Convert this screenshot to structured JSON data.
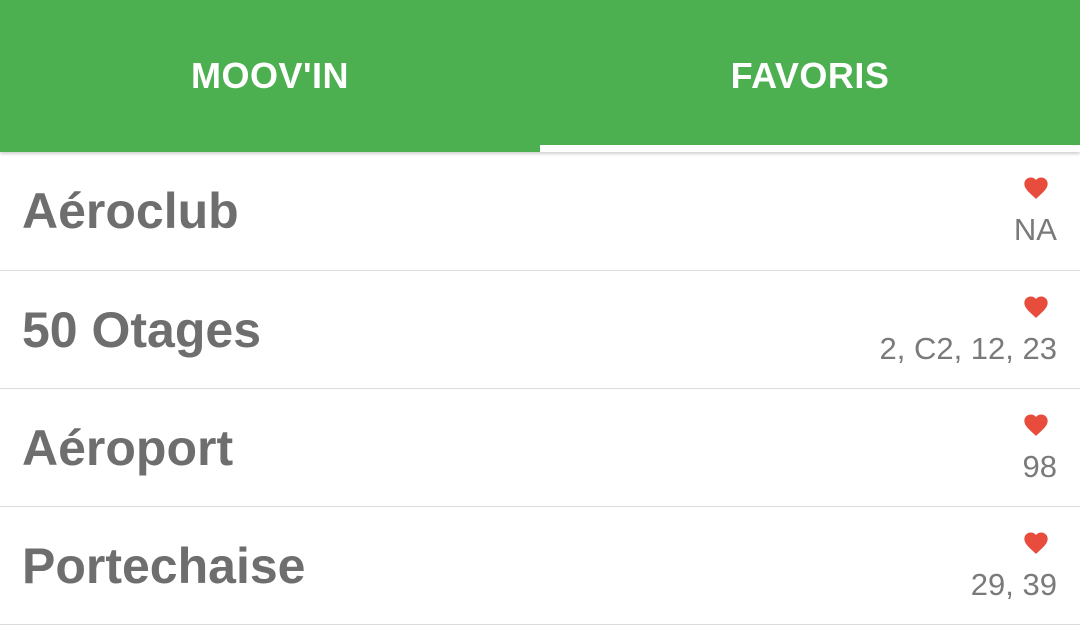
{
  "tabs": [
    {
      "label": "MOOV'IN",
      "active": false
    },
    {
      "label": "FAVORIS",
      "active": true
    }
  ],
  "colors": {
    "accent": "#4caf50",
    "heart": "#e74c3c",
    "text": "#6e6e6e"
  },
  "favorites": [
    {
      "name": "Aéroclub",
      "lines": "NA",
      "icon": "heart-icon"
    },
    {
      "name": "50 Otages",
      "lines": "2, C2, 12, 23",
      "icon": "heart-icon"
    },
    {
      "name": "Aéroport",
      "lines": "98",
      "icon": "heart-icon"
    },
    {
      "name": "Portechaise",
      "lines": "29, 39",
      "icon": "heart-icon"
    }
  ]
}
